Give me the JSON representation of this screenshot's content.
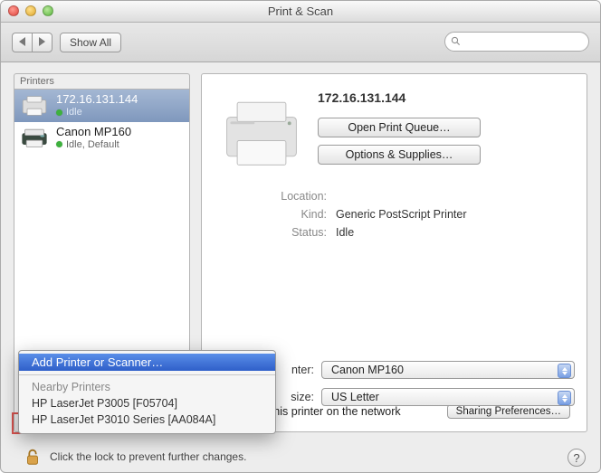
{
  "window": {
    "title": "Print & Scan"
  },
  "toolbar": {
    "show_all": "Show All",
    "search_placeholder": ""
  },
  "sidebar": {
    "header": "Printers",
    "items": [
      {
        "name": "172.16.131.144",
        "status": "Idle",
        "selected": true
      },
      {
        "name": "Canon MP160",
        "status": "Idle, Default",
        "selected": false
      }
    ],
    "add_glyph": "+",
    "remove_glyph": "−"
  },
  "detail": {
    "name": "172.16.131.144",
    "open_queue": "Open Print Queue…",
    "options_supplies": "Options & Supplies…",
    "rows": {
      "location_k": "Location:",
      "location_v": "",
      "kind_k": "Kind:",
      "kind_v": "Generic PostScript Printer",
      "status_k": "Status:",
      "status_v": "Idle"
    },
    "share_label": "Share this printer on the network",
    "sharing_prefs": "Sharing Preferences…"
  },
  "defaults": {
    "printer_label_suffix": "nter:",
    "printer_value": "Canon MP160",
    "paper_label_suffix": "size:",
    "paper_value": "US Letter"
  },
  "popup": {
    "add": "Add Printer or Scanner…",
    "nearby": "Nearby Printers",
    "items": [
      "HP LaserJet P3005 [F05704]",
      "HP LaserJet P3010 Series [AA084A]"
    ]
  },
  "lockrow": {
    "text": "Click the lock to prevent further changes."
  },
  "help": {
    "glyph": "?"
  }
}
